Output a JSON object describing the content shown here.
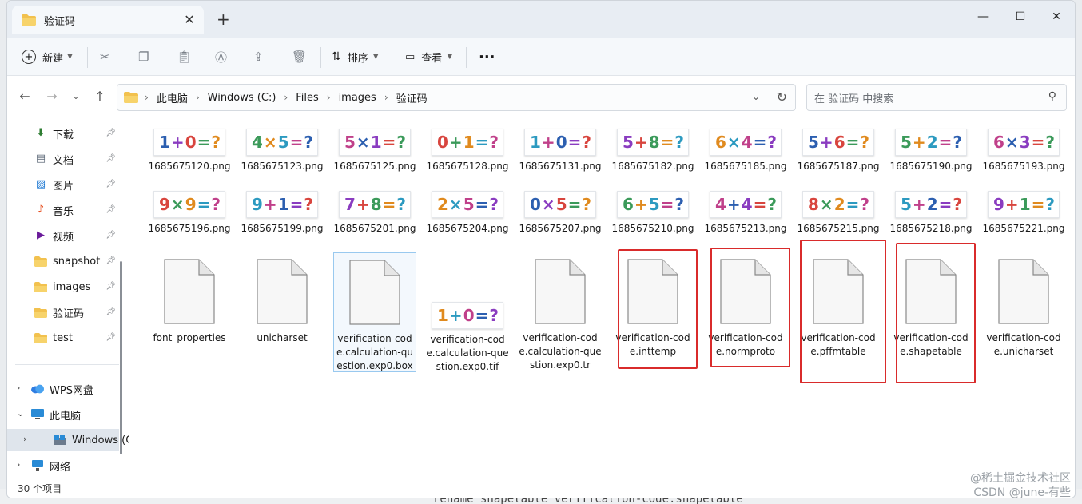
{
  "window": {
    "tab_title": "验证码",
    "new_tab": "+",
    "minimize": "—",
    "maximize": "☐",
    "close": "✕"
  },
  "toolbar": {
    "new_label": "新建",
    "sort_label": "排序",
    "view_label": "查看",
    "more_label": "···"
  },
  "address": {
    "breadcrumbs": [
      "此电脑",
      "Windows (C:)",
      "Files",
      "images",
      "验证码"
    ],
    "search_placeholder": "在 验证码 中搜索"
  },
  "sidebar": {
    "quick": [
      {
        "label": "下载",
        "icon": "download-icon",
        "color": "#2e7d32"
      },
      {
        "label": "文档",
        "icon": "document-icon",
        "color": "#5f6b7a"
      },
      {
        "label": "图片",
        "icon": "picture-icon",
        "color": "#1976d2"
      },
      {
        "label": "音乐",
        "icon": "music-icon",
        "color": "#e64a19"
      },
      {
        "label": "视频",
        "icon": "video-icon",
        "color": "#6a1b9a"
      },
      {
        "label": "snapshot",
        "icon": "folder-icon",
        "color": "#f2c14e"
      },
      {
        "label": "images",
        "icon": "folder-icon",
        "color": "#f2c14e"
      },
      {
        "label": "验证码",
        "icon": "folder-icon",
        "color": "#f2c14e"
      },
      {
        "label": "test",
        "icon": "folder-icon",
        "color": "#f2c14e"
      }
    ],
    "tree": [
      {
        "label": "WPS网盘",
        "icon": "cloud-icon"
      },
      {
        "label": "此电脑",
        "icon": "computer-icon"
      },
      {
        "label": "Windows (C:",
        "icon": "drive-icon"
      },
      {
        "label": "网络",
        "icon": "network-icon"
      }
    ]
  },
  "files": {
    "row1": [
      {
        "name": "1685675120.png",
        "captcha": "1+0=?"
      },
      {
        "name": "1685675123.png",
        "captcha": "4×5=?"
      },
      {
        "name": "1685675125.png",
        "captcha": "5×1=?"
      },
      {
        "name": "1685675128.png",
        "captcha": "0+1=?"
      },
      {
        "name": "1685675131.png",
        "captcha": "1+0=?"
      },
      {
        "name": "1685675182.png",
        "captcha": "5+8=?"
      },
      {
        "name": "1685675185.png",
        "captcha": "6×4=?"
      },
      {
        "name": "1685675187.png",
        "captcha": "5+6=?"
      },
      {
        "name": "1685675190.png",
        "captcha": "5+2=?"
      },
      {
        "name": "1685675193.png",
        "captcha": "6×3=?"
      }
    ],
    "row2": [
      {
        "name": "1685675196.png",
        "captcha": "9×9=?"
      },
      {
        "name": "1685675199.png",
        "captcha": "9+1=?"
      },
      {
        "name": "1685675201.png",
        "captcha": "7+8=?"
      },
      {
        "name": "1685675204.png",
        "captcha": "2×5=?"
      },
      {
        "name": "1685675207.png",
        "captcha": "0×5=?"
      },
      {
        "name": "1685675210.png",
        "captcha": "6+5=?"
      },
      {
        "name": "1685675213.png",
        "captcha": "4+4=?"
      },
      {
        "name": "1685675215.png",
        "captcha": "8×2=?"
      },
      {
        "name": "1685675218.png",
        "captcha": "5+2=?"
      },
      {
        "name": "1685675221.png",
        "captcha": "9+1=?"
      }
    ],
    "row3": [
      {
        "name": "font_properties"
      },
      {
        "name": "unicharset"
      },
      {
        "name": "verification-code.calculation-question.exp0.box"
      },
      {
        "name": "verification-code.calculation-question.exp0.tif",
        "captcha": "1+0=?"
      },
      {
        "name": "verification-code.calculation-question.exp0.tr"
      },
      {
        "name": "verification-code.inttemp"
      },
      {
        "name": "verification-code.normproto"
      },
      {
        "name": "verification-code.pffmtable"
      },
      {
        "name": "verification-code.shapetable"
      },
      {
        "name": "verification-code.unicharset"
      }
    ]
  },
  "status": {
    "item_count": "30 个项目"
  },
  "backdrop": {
    "bottom_text": "rename shapetable verification-code.shapetable",
    "watermark_line1": "@稀土掘金技术社区",
    "watermark_line2": "CSDN @june-有些"
  },
  "colors": {
    "highlight_red": "#d92b2b",
    "selection_blue": "#99c9ef",
    "folder_yellow": "#f2c14e"
  }
}
